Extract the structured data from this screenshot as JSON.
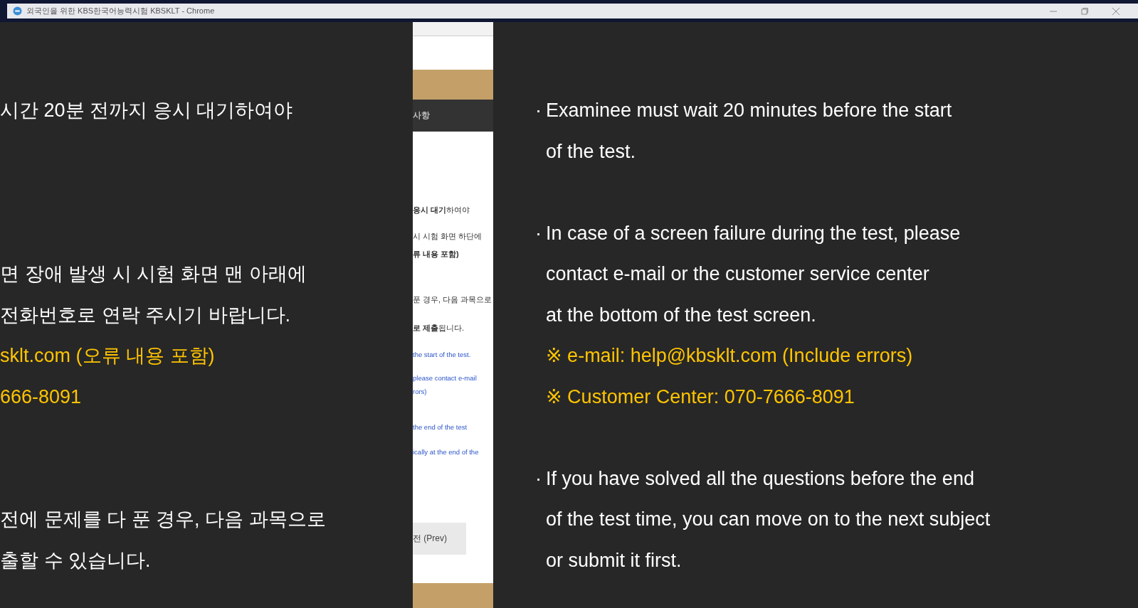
{
  "window": {
    "title": "외국인을 위한 KBS한국어능력시험 KBSKLT - Chrome"
  },
  "page_strip": {
    "tab_text": "사항",
    "fragments": [
      {
        "kind": "ko",
        "text": "**응시 대기**하여야"
      },
      {
        "kind": "ko",
        "text": "시 시험 화면 하단에"
      },
      {
        "kind": "ko-bold",
        "text": "류 내용 포함)"
      },
      {
        "kind": "ko",
        "text": "푼 경우, 다음 과목으로"
      },
      {
        "kind": "ko",
        "text": "**로 제출**됩니다."
      },
      {
        "kind": "en",
        "text": "the start of the test."
      },
      {
        "kind": "en",
        "text": "please contact e-mail"
      },
      {
        "kind": "en",
        "text": "rors)"
      },
      {
        "kind": "en",
        "text": "the end of the test"
      },
      {
        "kind": "en",
        "text": "ically at the end of the"
      }
    ],
    "button_text": "전 (Prev)"
  },
  "subtitles": {
    "left": [
      {
        "lines": [
          {
            "text": "시간 20분 전까지 응시 대기하여야",
            "highlight": false
          }
        ]
      },
      {
        "lines": [
          {
            "text": "면 장애 발생 시 시험 화면 맨 아래에",
            "highlight": false
          },
          {
            "text": "전화번호로 연락 주시기 바랍니다.",
            "highlight": false
          },
          {
            "text": "sklt.com (오류 내용 포함)",
            "highlight": true
          },
          {
            "text": "666-8091",
            "highlight": true
          }
        ]
      },
      {
        "lines": [
          {
            "text": "전에 문제를 다 푼 경우, 다음 과목으로",
            "highlight": false
          },
          {
            "text": "출할 수 있습니다.",
            "highlight": false
          }
        ]
      }
    ],
    "right": [
      {
        "bullet": "·",
        "lines": [
          {
            "text": "Examinee must wait 20 minutes before the start",
            "highlight": false
          },
          {
            "text": "of the test.",
            "highlight": false
          }
        ]
      },
      {
        "bullet": "·",
        "lines": [
          {
            "text": "In case of a screen failure during the test, please",
            "highlight": false
          },
          {
            "text": "contact e-mail or the customer service center",
            "highlight": false
          },
          {
            "text": "at the bottom of the test screen.",
            "highlight": false
          },
          {
            "text": "※ e-mail: help@kbsklt.com (Include errors)",
            "highlight": true
          },
          {
            "text": "※ Customer Center: 070-7666-8091",
            "highlight": true
          }
        ]
      },
      {
        "bullet": "·",
        "lines": [
          {
            "text": "If you have solved all the questions before the end",
            "highlight": false
          },
          {
            "text": "of the test time, you can move on to the next subject",
            "highlight": false
          },
          {
            "text": "or submit it first.",
            "highlight": false
          }
        ]
      }
    ]
  }
}
